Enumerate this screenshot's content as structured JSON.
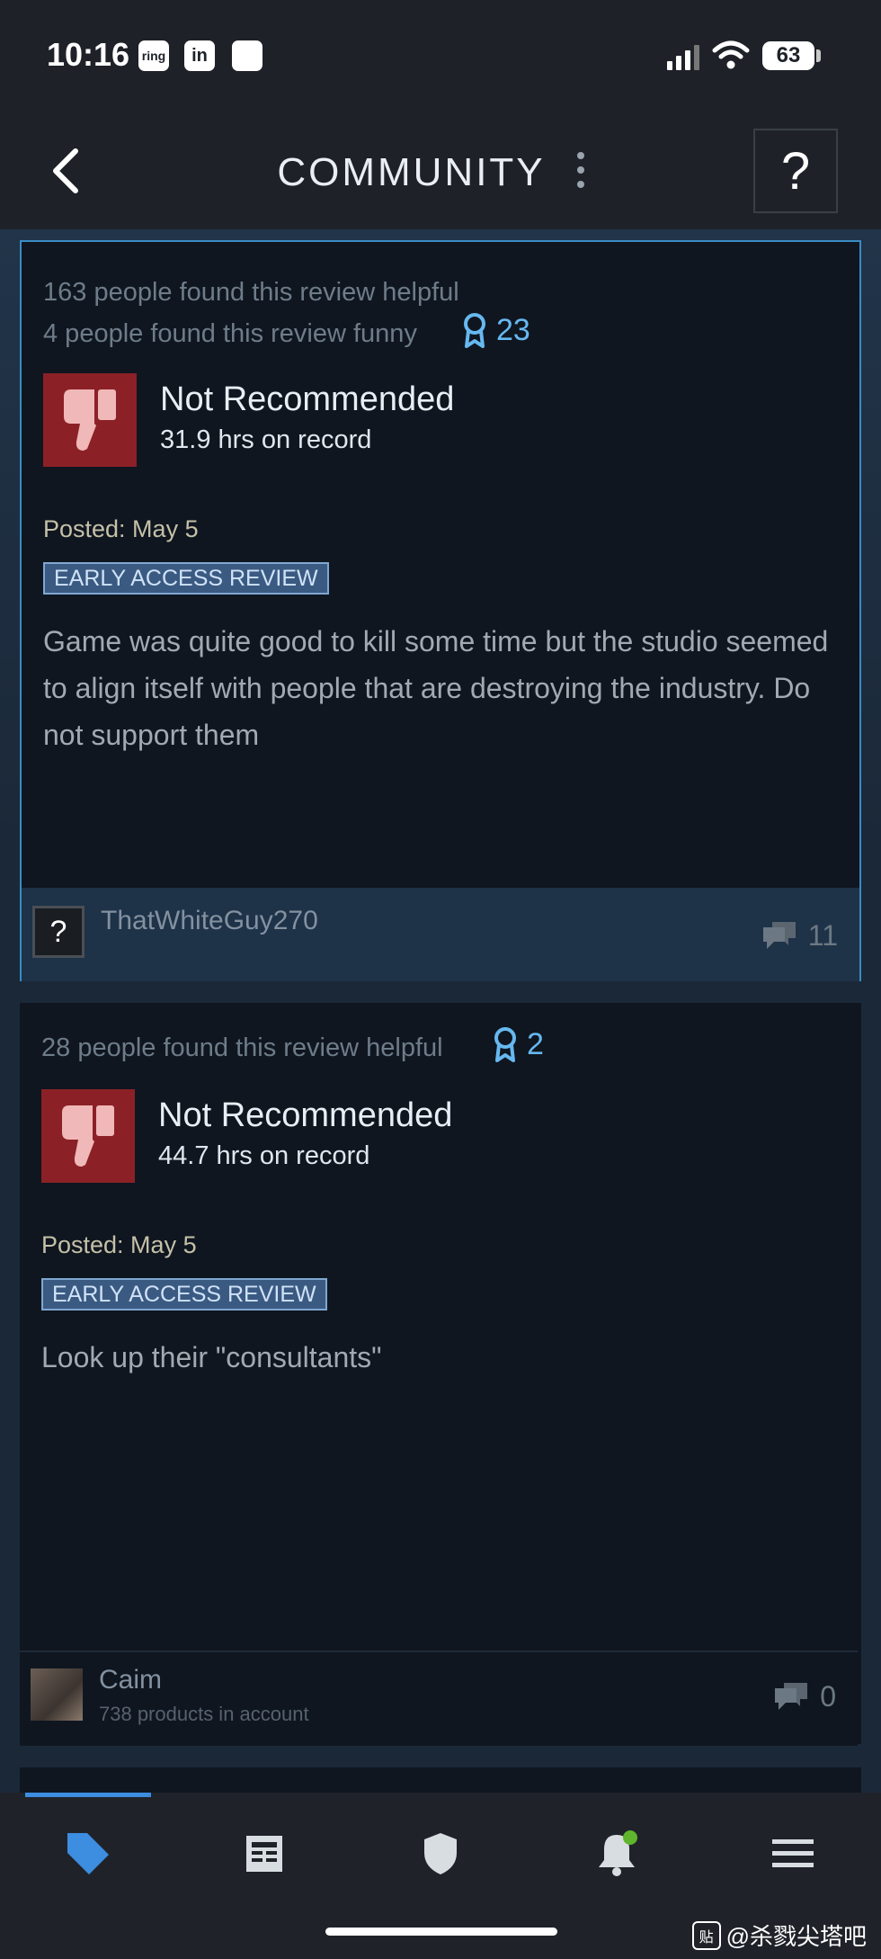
{
  "status_bar": {
    "time": "10:16",
    "app_icons": [
      "ring",
      "in",
      ""
    ],
    "battery": "63"
  },
  "header": {
    "title": "COMMUNITY",
    "help_label": "?"
  },
  "reviews": [
    {
      "helpful": "163 people found this review helpful",
      "funny": "4 people found this review funny",
      "awards": "23",
      "verdict": "Not Recommended",
      "hours": "31.9 hrs on record",
      "posted": "Posted: May 5",
      "badge": "EARLY ACCESS REVIEW",
      "text": "Game was quite good to kill some time but the studio seemed to align itself with people that are destroying the industry. Do not support them",
      "author": "ThatWhiteGuy270",
      "author_avatar_glyph": "?",
      "comment_count": "11"
    },
    {
      "helpful": "28 people found this review helpful",
      "awards": "2",
      "verdict": "Not Recommended",
      "hours": "44.7 hrs on record",
      "posted": "Posted: May 5",
      "badge": "EARLY ACCESS REVIEW",
      "text": "Look up their \"consultants\"",
      "author": "Caim",
      "author_products": "738 products in account",
      "comment_count": "0"
    }
  ],
  "nav": {
    "items": [
      "store-tag-icon",
      "news-icon",
      "shield-icon",
      "bell-icon",
      "menu-icon"
    ],
    "active": "store-tag-icon"
  },
  "watermark": {
    "icon_label": "贴",
    "text": "@杀戮尖塔吧"
  },
  "colors": {
    "accent": "#3d8de0",
    "award": "#67b8f0",
    "thumb_down": "#8b2126",
    "card_border": "#3a8bc4"
  }
}
